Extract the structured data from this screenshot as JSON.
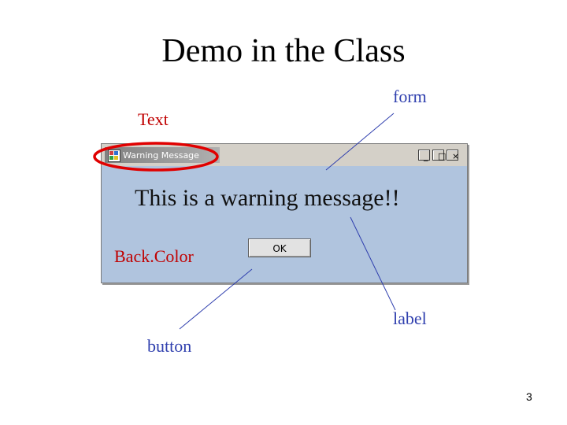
{
  "slide": {
    "title": "Demo in the Class",
    "page_number": "3"
  },
  "callouts": {
    "form": "form",
    "text": "Text",
    "backcolor": "Back.Color",
    "label": "label",
    "button": "button"
  },
  "window": {
    "title": "Warning Message",
    "message": "This is a warning message!!",
    "ok_label": "OK",
    "minimize": "_",
    "maximize": "□",
    "close": "×"
  },
  "colors": {
    "form_backcolor": "#b0c4de",
    "callout_blue": "#2f3fae",
    "callout_red": "#c00000",
    "highlight_ellipse": "#e00000"
  }
}
